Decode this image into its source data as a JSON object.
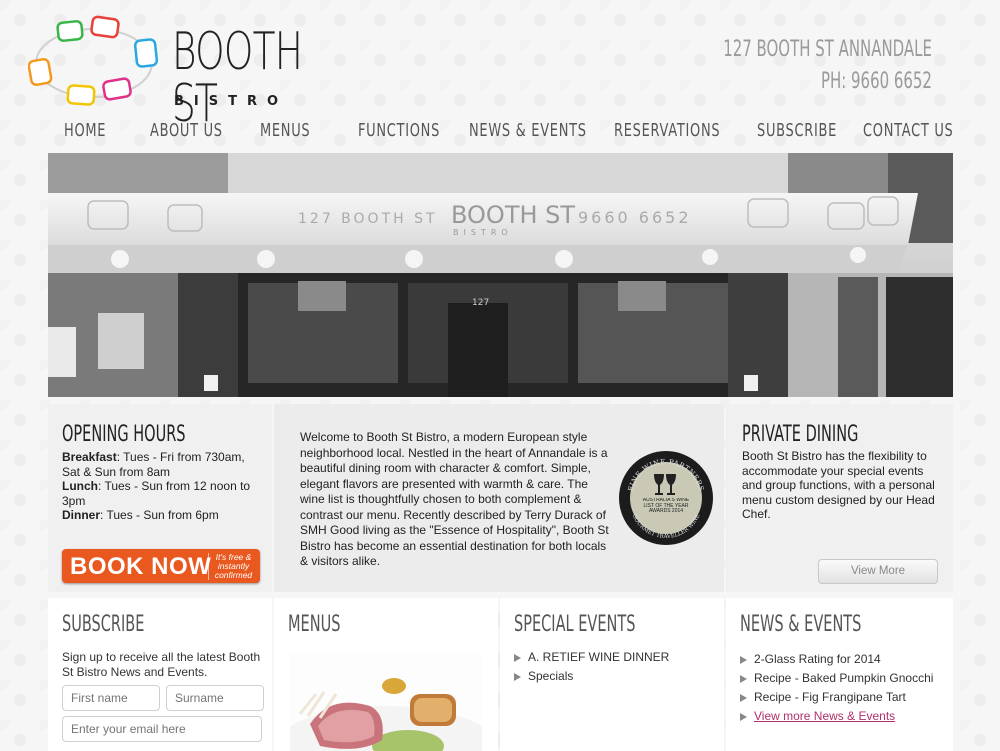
{
  "header": {
    "logo_title": "BOOTH ST",
    "logo_sub": "BISTRO",
    "address": "127 BOOTH ST ANNANDALE",
    "phone": "PH: 9660 6652"
  },
  "nav": {
    "items": [
      {
        "label": "HOME"
      },
      {
        "label": "ABOUT US"
      },
      {
        "label": "MENUS"
      },
      {
        "label": "FUNCTIONS"
      },
      {
        "label": "NEWS & EVENTS"
      },
      {
        "label": "RESERVATIONS"
      },
      {
        "label": "SUBSCRIBE"
      },
      {
        "label": "CONTACT US"
      }
    ]
  },
  "hero": {
    "awning_address": "127 BOOTH ST",
    "awning_logo": "BOOTH ST",
    "awning_logo_sub": "BISTRO",
    "awning_phone": "9660 6652",
    "door_number": "127"
  },
  "opening_hours": {
    "heading": "OPENING HOURS",
    "rows": [
      {
        "label": "Breakfast",
        "text": ": Tues - Fri from 730am, Sat & Sun from 8am"
      },
      {
        "label": "Lunch",
        "text": ": Tues - Sun from 12 noon to 3pm"
      },
      {
        "label": "Dinner",
        "text": ": Tues - Sun from 6pm"
      }
    ],
    "book_label": "BOOK NOW",
    "book_side": "It's free & instantly confirmed"
  },
  "welcome": {
    "text": "Welcome to Booth St Bistro, a modern European style neighborhood local. Nestled in the heart of Annandale is a beautiful dining room with character & comfort. Simple, elegant flavors are presented with warmth & care.  The wine list is thoughtfully chosen to both complement & contrast our menu.  Recently described by Terry Durack of SMH Good living as the \"Essence of Hospitality\", Booth St Bistro has become an essential destination for both locals & visitors alike.",
    "badge_top": "FINE WINE PARTNERS",
    "badge_mid": "AUSTRALIA'S WINE LIST OF THE YEAR AWARDS 2014",
    "badge_bottom": "GOURMET TRAVELLER WINE"
  },
  "private_dining": {
    "heading": "PRIVATE DINING",
    "text": "Booth St Bistro has the flexibility to accommodate your special events and group functions, with a personal menu custom designed by our Head Chef.",
    "button": "View More"
  },
  "subscribe": {
    "heading": "SUBSCRIBE",
    "text": "Sign up to receive all the latest Booth St Bistro News and Events.",
    "first_name_placeholder": "First name",
    "surname_placeholder": "Surname",
    "email_placeholder": "Enter your email here"
  },
  "menus": {
    "heading": "MENUS"
  },
  "special_events": {
    "heading": "SPECIAL EVENTS",
    "items": [
      "A. RETIEF WINE DINNER",
      "Specials"
    ]
  },
  "news_events": {
    "heading": "NEWS & EVENTS",
    "items": [
      "2-Glass Rating for 2014",
      "Recipe - Baked Pumpkin Gnocchi",
      "Recipe - Fig Frangipane Tart"
    ],
    "more_link": "View more News & Events"
  },
  "colors": {
    "book_button": "#e8581f",
    "link": "#b0306a",
    "ring_colors": [
      "#3ab54a",
      "#e8403a",
      "#2aa8e0",
      "#f39a1e",
      "#f2c500",
      "#e0308a"
    ]
  }
}
